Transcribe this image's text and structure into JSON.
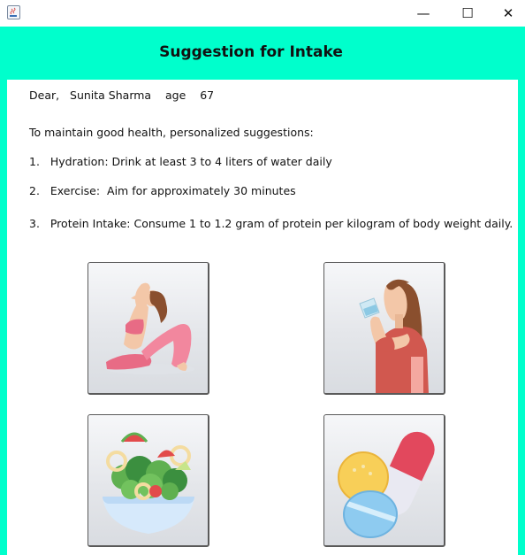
{
  "window": {
    "minimize_glyph": "—",
    "maximize_glyph": "☐",
    "close_glyph": "✕"
  },
  "header": {
    "title": "Suggestion for Intake"
  },
  "greeting": {
    "salutation": "Dear,",
    "name": "Sunita Sharma",
    "age_label": "age",
    "age_value": "67"
  },
  "intro": "To maintain good health, personalized suggestions:",
  "suggestions": [
    {
      "number": "1.",
      "text": "Hydration: Drink at least 3 to 4 liters of water daily"
    },
    {
      "number": "2.",
      "text": "Exercise:  Aim for approximately 30 minutes"
    },
    {
      "number": "3.",
      "text": "Protein Intake: Consume 1 to 1.2 gram of protein per kilogram of body weight daily."
    }
  ],
  "tiles": [
    {
      "icon": "yoga-pose-icon"
    },
    {
      "icon": "drinking-water-icon"
    },
    {
      "icon": "salad-bowl-icon"
    },
    {
      "icon": "supplement-pills-icon"
    }
  ],
  "colors": {
    "accent": "#00ffcc",
    "panel": "#ffffff",
    "text": "#111111"
  }
}
